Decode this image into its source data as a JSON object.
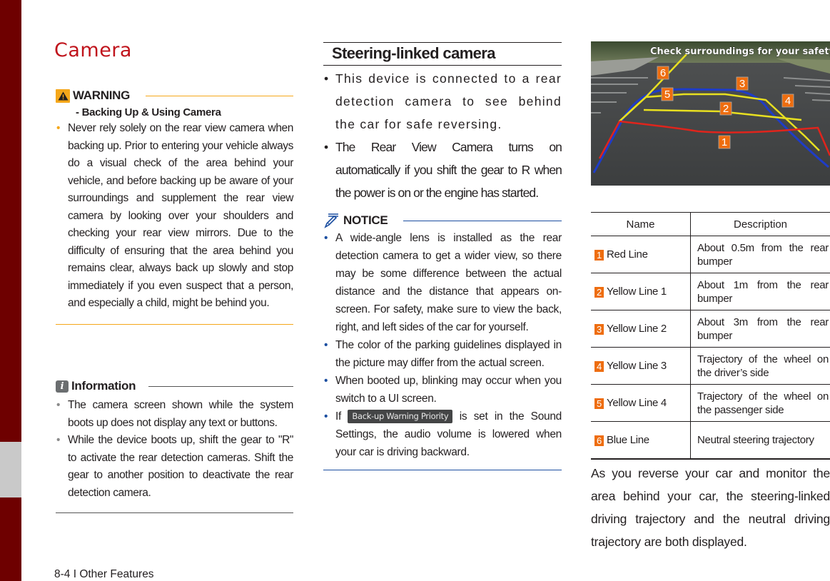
{
  "page": {
    "title": "Camera",
    "footer": "8-4 I Other Features"
  },
  "warning": {
    "label": "WARNING",
    "subtitle": "- Backing Up & Using Camera",
    "items": [
      "Never rely solely on the rear view camera when backing up. Prior to entering your vehicle always do a visual check of the area behind your vehicle, and before backing up be aware of your surroundings and supplement the rear view camera by looking over your shoulders and checking your rear view mirrors. Due to the difficulty of ensuring that the area behind you remains clear, always back up slowly and stop immediately if you even suspect that a person, and especially a child, might be behind you."
    ]
  },
  "information": {
    "label": "Information",
    "items": [
      "The camera screen shown while the system boots up does not display any text or buttons.",
      "While the device boots up, shift the gear to \"R\" to activate the rear detection cameras. Shift the gear to another position to deactivate the rear detection camera."
    ]
  },
  "steering": {
    "heading": "Steering-linked camera",
    "items": [
      "This device is connected to a rear detection camera to see behind the car for safe reversing.",
      "The Rear View Camera turns on automatically if you shift the gear to R when the power is on or the engine has started."
    ]
  },
  "notice": {
    "label": "NOTICE",
    "items": [
      "A wide-angle lens is installed as the rear detection camera to get a wider view, so there may be some difference between the actual distance and the distance that appears on-screen. For safety, make sure to view the back, right, and left sides of the car for yourself.",
      "The color of the parking guidelines displayed in the picture may differ from the actual screen.",
      "When booted up, blinking may occur when you switch to a UI screen."
    ],
    "last_item": {
      "prefix": "If",
      "chip": "Back-up Warning Priority",
      "suffix": "is set in the Sound Settings, the audio volume is lowered when your car is driving backward."
    }
  },
  "camera_view": {
    "overlay_text": "Check surroundings for your safety.",
    "markers": [
      "1",
      "2",
      "3",
      "4",
      "5",
      "6"
    ],
    "colors": {
      "red": "#e0241c",
      "yellow": "#e8e020",
      "blue": "#1e3cc8",
      "marker": "#ee6d0f"
    }
  },
  "legend_table": {
    "headers": [
      "Name",
      "Description"
    ],
    "rows": [
      {
        "num": "1",
        "name": "Red Line",
        "desc": "About 0.5m from the rear bumper"
      },
      {
        "num": "2",
        "name": "Yellow Line 1",
        "desc": "About 1m from the rear bumper"
      },
      {
        "num": "3",
        "name": "Yellow Line 2",
        "desc": "About 3m from the rear bumper"
      },
      {
        "num": "4",
        "name": "Yellow Line 3",
        "desc": "Trajectory of the wheel on the driver’s side"
      },
      {
        "num": "5",
        "name": "Yellow Line 4",
        "desc": "Trajectory of the wheel on the passenger side"
      },
      {
        "num": "6",
        "name": "Blue Line",
        "desc": "Neutral steering trajectory"
      }
    ]
  },
  "summary": "As you reverse your car and monitor the area behind your car, the steering-linked driving trajectory and the neutral driving trajectory are both displayed.",
  "colors": {
    "title": "#c0141c",
    "sidebar": "#6e0000",
    "warning_accent": "#f5a71a",
    "notice_accent": "#1b4ea0"
  }
}
